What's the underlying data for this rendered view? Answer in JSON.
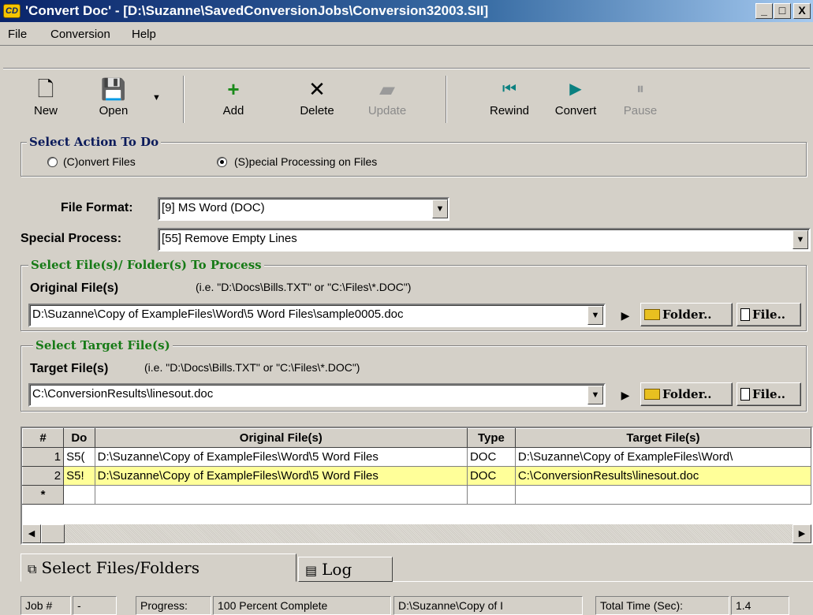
{
  "window": {
    "title": "'Convert Doc' - [D:\\Suzanne\\SavedConversionJobs\\Conversion32003.SII]",
    "app_icon_text": "CD",
    "minimize": "_",
    "maximize": "□",
    "close": "X"
  },
  "menu": [
    "File",
    "Conversion",
    "Help"
  ],
  "toolbar": {
    "new": "New",
    "open": "Open",
    "add": "Add",
    "delete": "Delete",
    "update": "Update",
    "rewind": "Rewind",
    "convert": "Convert",
    "pause": "Pause"
  },
  "action_group": {
    "title": "Select Action To Do",
    "convert_files": "(C)onvert Files",
    "special_processing": "(S)pecial Processing on Files",
    "selected": "special_processing"
  },
  "file_format": {
    "label": "File Format:",
    "value": "[9] MS Word (DOC)"
  },
  "special_process": {
    "label": "Special Process:",
    "value": "[55] Remove Empty Lines"
  },
  "source_group": {
    "title": "Select File(s)/ Folder(s) To Process",
    "label": "Original File(s)",
    "hint": "(i.e. \"D:\\Docs\\Bills.TXT\"  or \"C:\\Files\\*.DOC\")",
    "value": "D:\\Suzanne\\Copy of ExampleFiles\\Word\\5 Word Files\\sample0005.doc",
    "folder_button": "Folder..",
    "file_button": "File.."
  },
  "target_group": {
    "title": "Select Target File(s)",
    "label": "Target File(s)",
    "hint": "(i.e. \"D:\\Docs\\Bills.TXT\"  or \"C:\\Files\\*.DOC\")",
    "value": "C:\\ConversionResults\\linesout.doc",
    "folder_button": "Folder..",
    "file_button": "File.."
  },
  "grid": {
    "columns": [
      "#",
      "Do",
      "Original File(s)",
      "Type",
      "Target File(s)"
    ],
    "rows": [
      [
        "1",
        "S5(",
        "D:\\Suzanne\\Copy of ExampleFiles\\Word\\5 Word Files",
        "DOC",
        "D:\\Suzanne\\Copy of ExampleFiles\\Word\\"
      ],
      [
        "2",
        "S5!",
        "D:\\Suzanne\\Copy of ExampleFiles\\Word\\5 Word Files",
        "DOC",
        "C:\\ConversionResults\\linesout.doc"
      ],
      [
        "*",
        "",
        "",
        "",
        ""
      ]
    ]
  },
  "tabs": [
    "Select Files/Folders",
    "Log"
  ],
  "status": {
    "job_label": "Job #",
    "job_value": "-",
    "progress_label": "Progress:",
    "progress_value": "100 Percent Complete",
    "current_file": "D:\\Suzanne\\Copy of I",
    "time_label": "Total Time (Sec):",
    "time_value": "1.4"
  }
}
